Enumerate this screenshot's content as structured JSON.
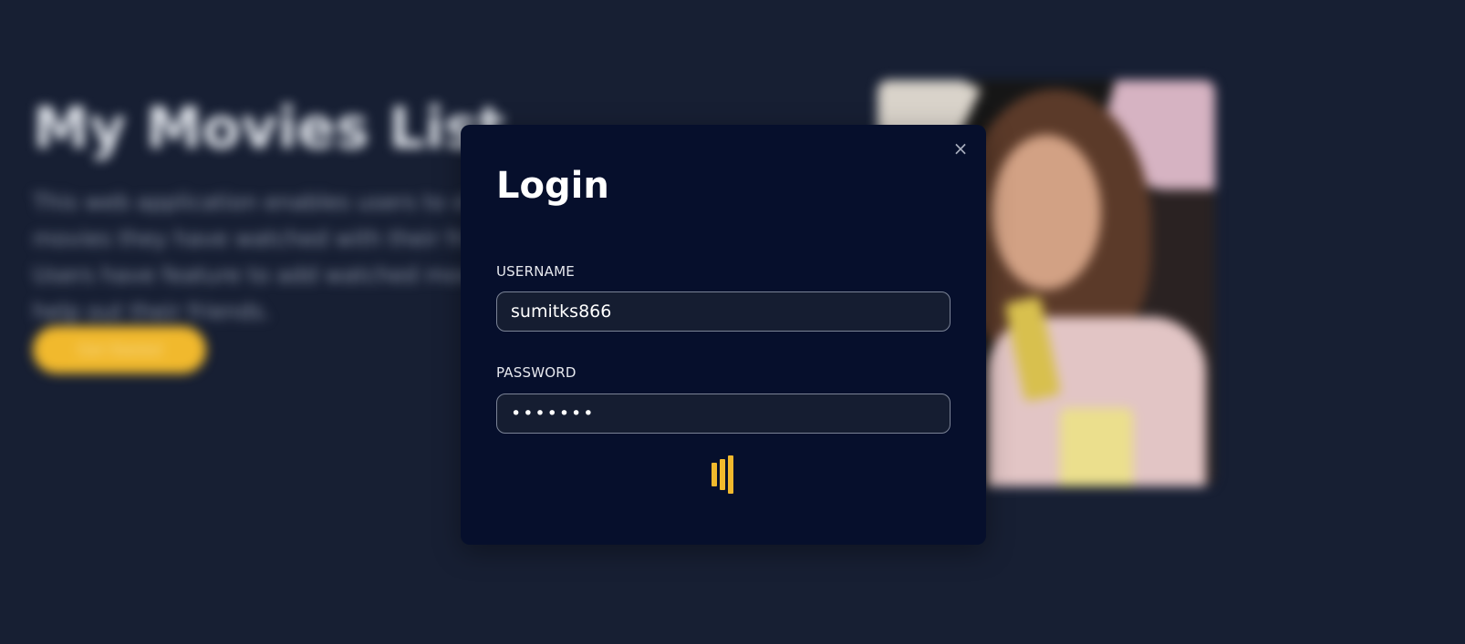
{
  "background": {
    "hero_title": "My Movies List",
    "hero_description": "This web application enables users to share movies they have watched with their friends. Users have feature to add watched movies to help out their friends.",
    "hero_button_label": "Get Started"
  },
  "modal": {
    "title": "Login",
    "close_icon": "×",
    "username_label": "USERNAME",
    "username_value": "sumitks866",
    "password_label": "PASSWORD",
    "password_value": "sumitks",
    "loading": true
  },
  "colors": {
    "page_background": "#171f33",
    "modal_background": "#060f2c",
    "accent": "#f1b92d",
    "input_border": "#7b8396"
  },
  "icons": {
    "close": "close-icon",
    "loader": "loading-bars-icon"
  }
}
